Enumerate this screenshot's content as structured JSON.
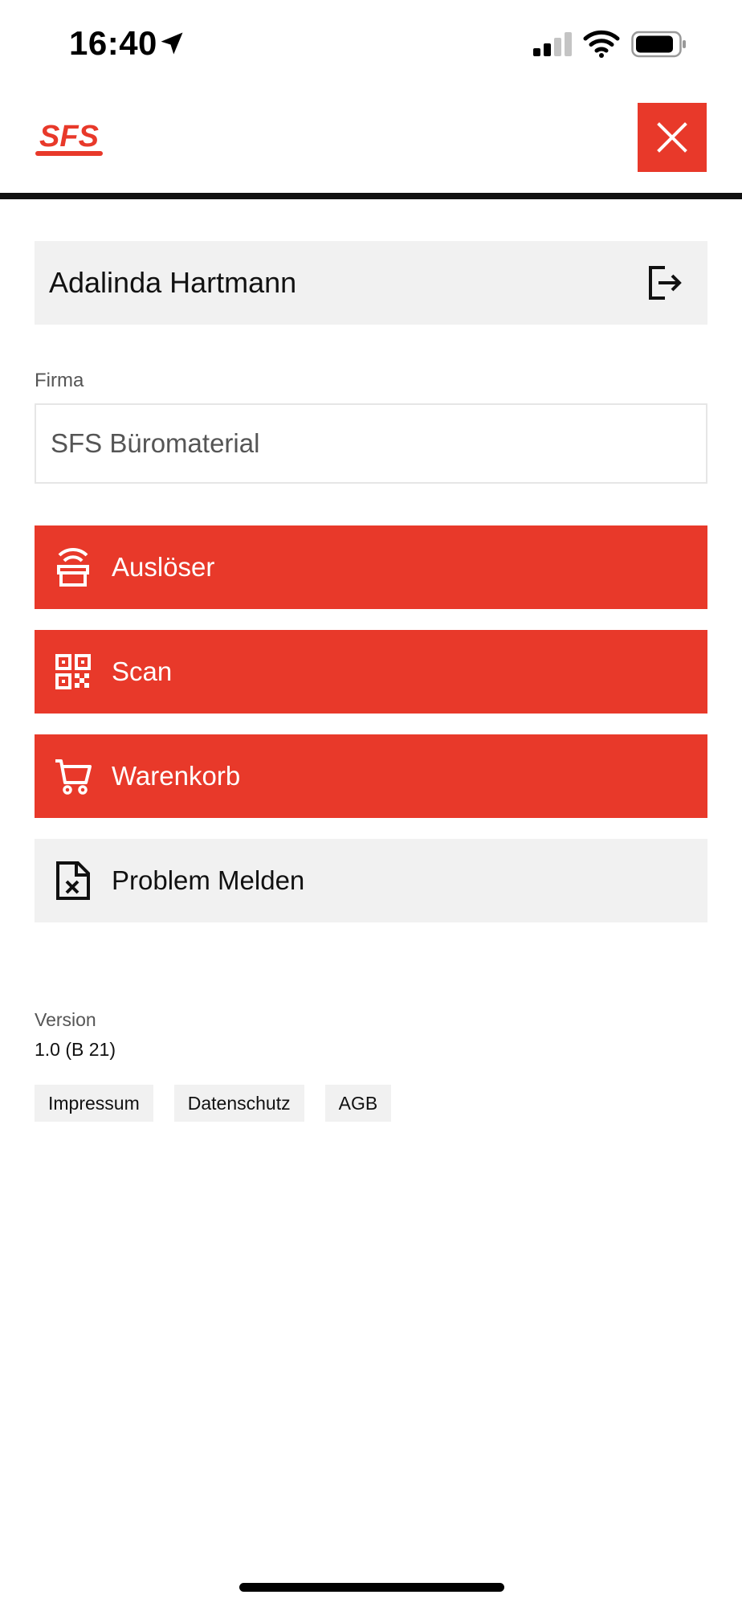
{
  "status_bar": {
    "time": "16:40",
    "location_icon": "location-arrow-icon",
    "signal_icon": "cellular-signal-icon",
    "wifi_icon": "wifi-icon",
    "battery_icon": "battery-icon"
  },
  "header": {
    "logo_text": "SFS",
    "close_icon": "close-icon"
  },
  "user": {
    "name": "Adalinda Hartmann",
    "logout_icon": "logout-icon"
  },
  "firma": {
    "label": "Firma",
    "value": "SFS Büromaterial"
  },
  "menu": {
    "ausloser": {
      "label": "Auslöser",
      "icon": "trigger-box-icon"
    },
    "scan": {
      "label": "Scan",
      "icon": "qr-code-icon"
    },
    "warenkorb": {
      "label": "Warenkorb",
      "icon": "cart-icon"
    },
    "problem": {
      "label": "Problem Melden",
      "icon": "document-x-icon"
    }
  },
  "version": {
    "label": "Version",
    "value": "1.0 (B 21)"
  },
  "links": {
    "impressum": "Impressum",
    "datenschutz": "Datenschutz",
    "agb": "AGB"
  },
  "colors": {
    "accent": "#E8392A",
    "light_grey": "#F1F1F1",
    "text": "#111111"
  }
}
